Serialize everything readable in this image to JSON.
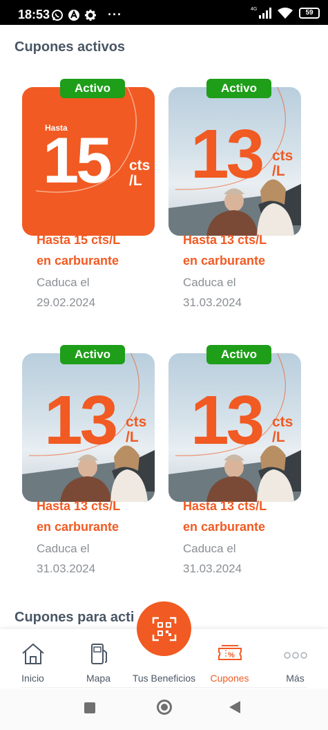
{
  "status_bar": {
    "time": "18:53",
    "network": "4G",
    "battery": "59",
    "left_icons": [
      "whatsapp-icon",
      "app-icon",
      "settings-icon",
      "more-icon"
    ],
    "more": "···"
  },
  "sections": {
    "active_title": "Cupones activos",
    "to_activate_title": "Cupones para acti"
  },
  "coupons": [
    {
      "badge": "Activo",
      "title_line1": "Hasta 15 cts/L",
      "title_line2": "en carburante",
      "expiry_line1": "Caduca el",
      "expiry_line2": "29.02.2024",
      "art_prefix": "Hasta",
      "art_number": "15",
      "art_unit_top": "cts",
      "art_unit_bottom": "/L",
      "style": "orange"
    },
    {
      "badge": "Activo",
      "title_line1": "Hasta 13 cts/L",
      "title_line2": "en carburante",
      "expiry_line1": "Caduca el",
      "expiry_line2": "31.03.2024",
      "art_number": "13",
      "art_unit_top": "cts",
      "art_unit_bottom": "/L",
      "style": "photo"
    },
    {
      "badge": "Activo",
      "title_line1": "Hasta 13 cts/L",
      "title_line2": "en carburante",
      "expiry_line1": "Caduca el",
      "expiry_line2": "31.03.2024",
      "art_number": "13",
      "art_unit_top": "cts",
      "art_unit_bottom": "/L",
      "style": "photo"
    },
    {
      "badge": "Activo",
      "title_line1": "Hasta 13 cts/L",
      "title_line2": "en carburante",
      "expiry_line1": "Caduca el",
      "expiry_line2": "31.03.2024",
      "art_number": "13",
      "art_unit_top": "cts",
      "art_unit_bottom": "/L",
      "style": "photo"
    }
  ],
  "bottom_nav": {
    "items": [
      {
        "label": "Inicio",
        "icon": "home-icon",
        "active": false
      },
      {
        "label": "Mapa",
        "icon": "fuel-pump-icon",
        "active": false
      },
      {
        "label": "Tus Beneficios",
        "icon": "qr-code-icon",
        "active": false
      },
      {
        "label": "Cupones",
        "icon": "coupon-icon",
        "active": true
      },
      {
        "label": "Más",
        "icon": "more-dots-icon",
        "active": false
      }
    ]
  },
  "colors": {
    "brand_orange": "#f15a22",
    "badge_green": "#1e9e19",
    "title_gray": "#4a5665",
    "expiry_gray": "#8a8f94"
  }
}
